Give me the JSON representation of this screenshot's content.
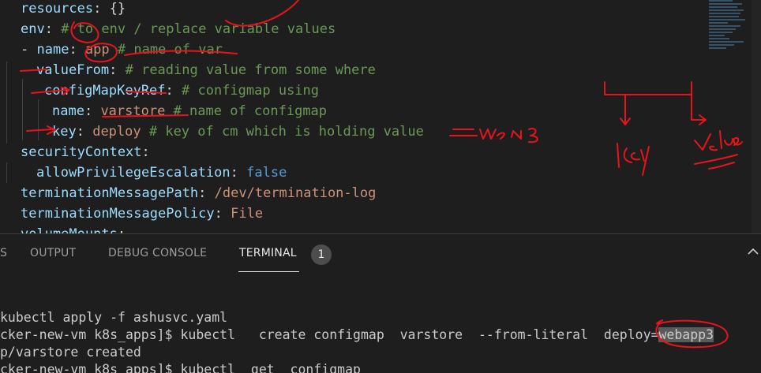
{
  "editor": {
    "l1": {
      "key": "resources",
      "sep": ": ",
      "val": "{}"
    },
    "l2": {
      "key": "env",
      "sep": ": ",
      "comment": "# to env / replace variable values"
    },
    "l3": {
      "dash": "- ",
      "key": "name",
      "sep": ": ",
      "val": "app",
      "comment": " # name of var"
    },
    "l4": {
      "key": "valueFrom",
      "sep": ": ",
      "comment": "# reading value from some where"
    },
    "l5": {
      "key": "configMapKeyRef",
      "sep": ": ",
      "comment": "# configmap using"
    },
    "l6": {
      "key": "name",
      "sep": ": ",
      "val": "varstore",
      "comment": " # name of configmap"
    },
    "l7": {
      "key": "key",
      "sep": ": ",
      "val": "deploy",
      "comment": " # key of cm which is holding value"
    },
    "l8": {
      "key": "securityContext",
      "sep": ":"
    },
    "l9": {
      "key": "allowPrivilegeEscalation",
      "sep": ": ",
      "val": "false"
    },
    "l10": {
      "key": "terminationMessagePath",
      "sep": ": ",
      "val": "/dev/termination-log"
    },
    "l11": {
      "key": "terminationMessagePolicy",
      "sep": ": ",
      "val": "File"
    },
    "l12": {
      "key": "volumeMounts",
      "sep": ":"
    }
  },
  "annotations": {
    "wen3": "wen3",
    "key": "key",
    "value": "Value"
  },
  "panel": {
    "tab_problems": "S",
    "tab_output": "OUTPUT",
    "tab_debug": "DEBUG CONSOLE",
    "tab_terminal": "TERMINAL",
    "terminal_count": "1"
  },
  "terminal": {
    "line1": "kubectl apply -f ashusvc.yaml",
    "line2_prefix": "cker-new-vm k8s_apps]$ kubectl   create configmap  varstore  --from-literal  deploy=",
    "line2_selected": "webapp3",
    "line3": "p/varstore created",
    "line4": "cker-new-vm k8s_apps]$ kubectl  get  configmap"
  },
  "colors": {
    "key": "#9cdcfe",
    "comment": "#6a9955",
    "string": "#ce9178",
    "keyword": "#569cd6",
    "ink": "#e8141c"
  }
}
